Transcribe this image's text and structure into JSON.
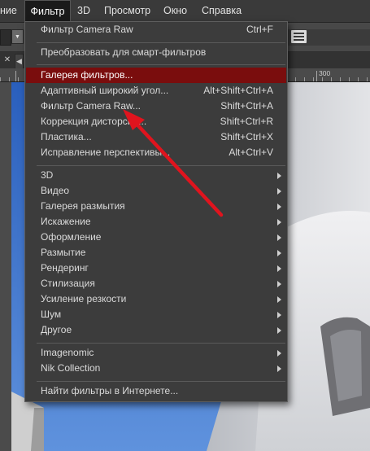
{
  "menubar": {
    "items": [
      {
        "label": "ние"
      },
      {
        "label": "Фильтр"
      },
      {
        "label": "3D"
      },
      {
        "label": "Просмотр"
      },
      {
        "label": "Окно"
      },
      {
        "label": "Справка"
      }
    ]
  },
  "ruler": {
    "label": "300"
  },
  "menu": {
    "top_items": [
      {
        "label": "Фильтр Camera Raw",
        "shortcut": "Ctrl+F"
      },
      {
        "label": "Преобразовать для смарт-фильтров",
        "shortcut": ""
      }
    ],
    "filter_items": [
      {
        "label": "Галерея фильтров...",
        "shortcut": "",
        "highlighted": true
      },
      {
        "label": "Адаптивный широкий угол...",
        "shortcut": "Alt+Shift+Ctrl+A"
      },
      {
        "label": "Фильтр Camera Raw...",
        "shortcut": "Shift+Ctrl+A"
      },
      {
        "label": "Коррекция дисторсии...",
        "shortcut": "Shift+Ctrl+R"
      },
      {
        "label": "Пластика...",
        "shortcut": "Shift+Ctrl+X"
      },
      {
        "label": "Исправление перспективы...",
        "shortcut": "Alt+Ctrl+V"
      }
    ],
    "submenus": [
      {
        "label": "3D"
      },
      {
        "label": "Видео"
      },
      {
        "label": "Галерея размытия"
      },
      {
        "label": "Искажение"
      },
      {
        "label": "Оформление"
      },
      {
        "label": "Размытие"
      },
      {
        "label": "Рендеринг"
      },
      {
        "label": "Стилизация"
      },
      {
        "label": "Усиление резкости"
      },
      {
        "label": "Шум"
      },
      {
        "label": "Другое"
      }
    ],
    "plugins": [
      {
        "label": "Imagenomic"
      },
      {
        "label": "Nik Collection"
      }
    ],
    "bottom_item": {
      "label": "Найти фильтры в Интернете..."
    }
  },
  "colors": {
    "highlight": "#7a0d0d",
    "annotation_arrow": "#e0141e",
    "sky": "#2f69c8"
  }
}
